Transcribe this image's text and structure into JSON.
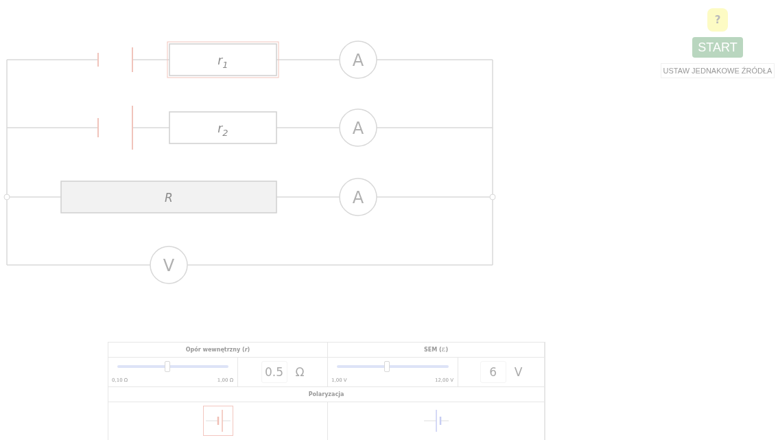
{
  "circuit": {
    "branches": [
      {
        "kind": "source",
        "resistor": {
          "symbol": "r",
          "index": "1"
        },
        "selected": true,
        "meter": "A"
      },
      {
        "kind": "source",
        "resistor": {
          "symbol": "r",
          "index": "2"
        },
        "selected": false,
        "meter": "A"
      },
      {
        "kind": "load",
        "resistor": {
          "symbol": "R"
        },
        "selected": false,
        "meter": "A"
      }
    ],
    "voltmeter": "V"
  },
  "side": {
    "help": "?",
    "start": "START",
    "equalize": "USTAW JEDNAKOWE ŹRÓDŁA"
  },
  "panel": {
    "sections": [
      {
        "title": "Opór wewnętrzny (*r*)",
        "min": "0,10 Ω",
        "max": "1,00 Ω",
        "level": 0.45,
        "value": "0.5",
        "unit": "Ω"
      },
      {
        "title": "SEM (*ℰ*)",
        "min": "1,00 V",
        "max": "12,00 V",
        "level": 0.45,
        "value": "6",
        "unit": "V"
      }
    ],
    "polarization": {
      "title": "Polaryzacja",
      "options": [
        {
          "kind": "short_first",
          "selected": true
        },
        {
          "kind": "long_first",
          "selected": false
        }
      ]
    }
  }
}
